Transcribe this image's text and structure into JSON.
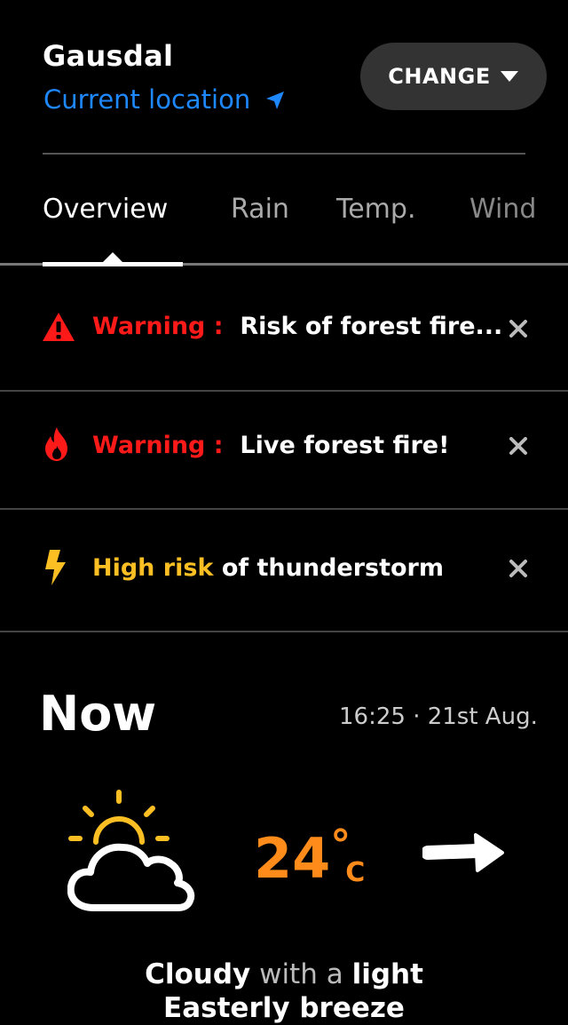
{
  "header": {
    "city": "Gausdal",
    "current_location": "Current location",
    "change_label": "CHANGE"
  },
  "tabs": [
    {
      "label": "Overview",
      "active": true
    },
    {
      "label": "Rain"
    },
    {
      "label": "Temp."
    },
    {
      "label": "Wind"
    }
  ],
  "alerts": [
    {
      "icon": "warning-triangle-icon",
      "prefix": "Warning :",
      "text": "Risk of forest fire..."
    },
    {
      "icon": "fire-icon",
      "prefix": "Warning :",
      "text": "Live forest fire!"
    },
    {
      "icon": "lightning-icon",
      "prefix": "High risk",
      "text": "of thunderstorm"
    }
  ],
  "now": {
    "title": "Now",
    "timestamp": "16:25 · 21st Aug.",
    "temperature": "24",
    "degree": "°",
    "unit": "C",
    "weather_icon": "partly-cloudy-icon",
    "wind_icon": "wind-arrow-icon",
    "desc": {
      "w1": "Cloudy",
      "w2": "with a",
      "w3": "light",
      "w4": "Easterly breeze"
    }
  },
  "colors": {
    "accent_blue": "#1e88ff",
    "warning_red": "#ff1a1a",
    "risk_yellow": "#fbbf24",
    "temp_orange": "#ff8c1a"
  }
}
